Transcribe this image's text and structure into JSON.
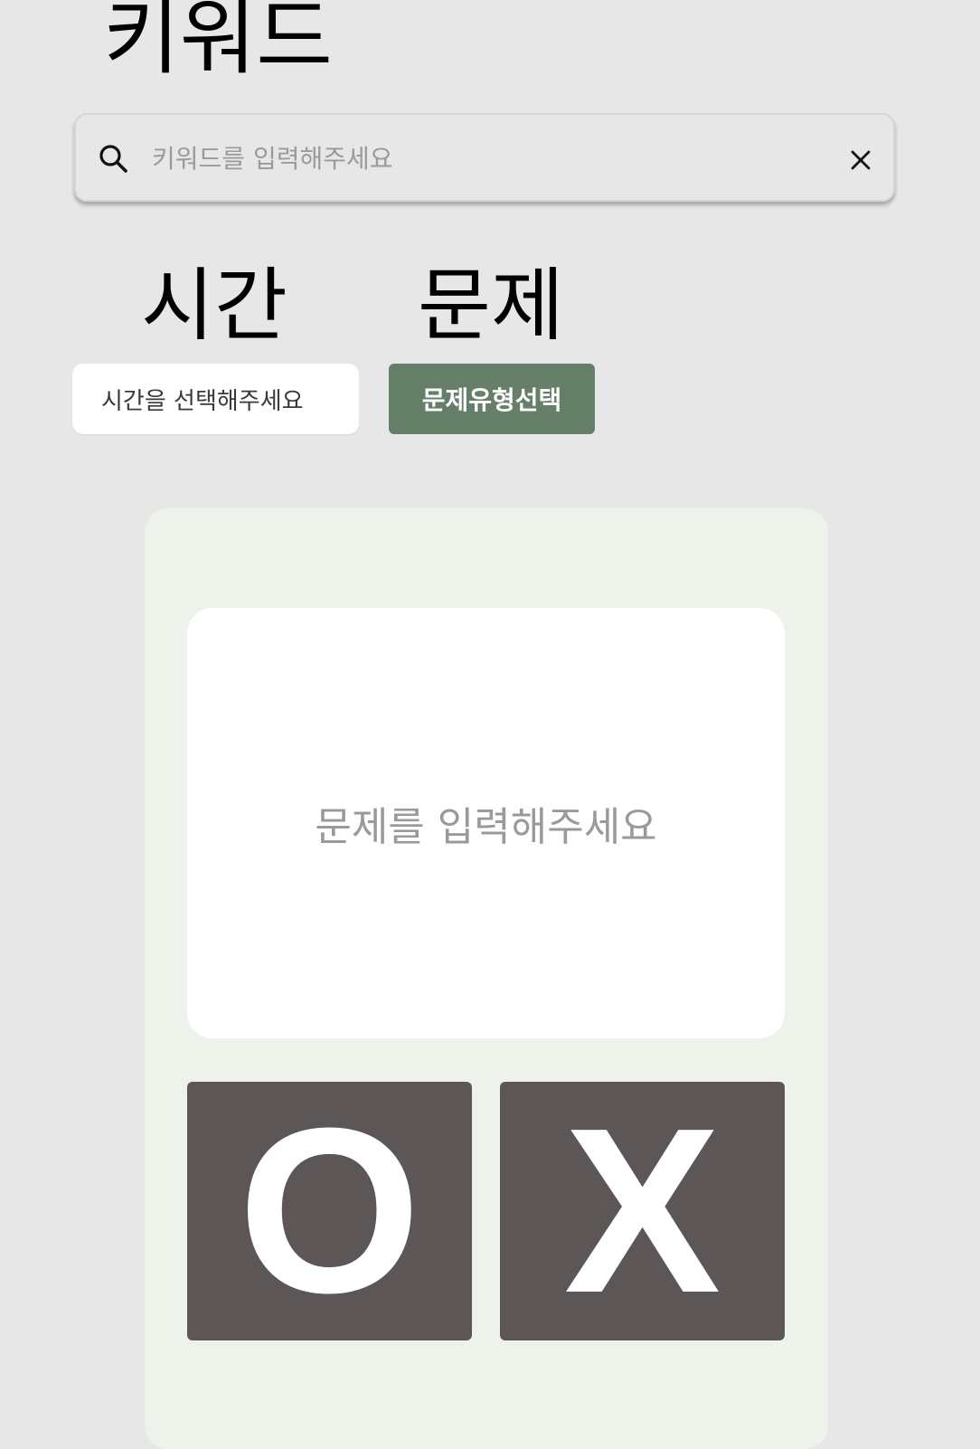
{
  "keyword_section": {
    "title": "키워드",
    "search": {
      "placeholder": "키워드를 입력해주세요",
      "value": ""
    }
  },
  "time_section": {
    "title": "시간",
    "select_label": "시간을 선택해주세요"
  },
  "problem_section": {
    "title": "문제",
    "type_button_label": "문제유형선택"
  },
  "quiz_card": {
    "question_placeholder": "문제를 입력해주세요",
    "answer_o_label": "O",
    "answer_x_label": "X"
  },
  "colors": {
    "background": "#e8e7e8",
    "accent_green": "#667f68",
    "card_background": "#edf2ea",
    "answer_button": "#5c5656"
  },
  "icons": {
    "search": "search-icon",
    "clear": "close-icon"
  }
}
